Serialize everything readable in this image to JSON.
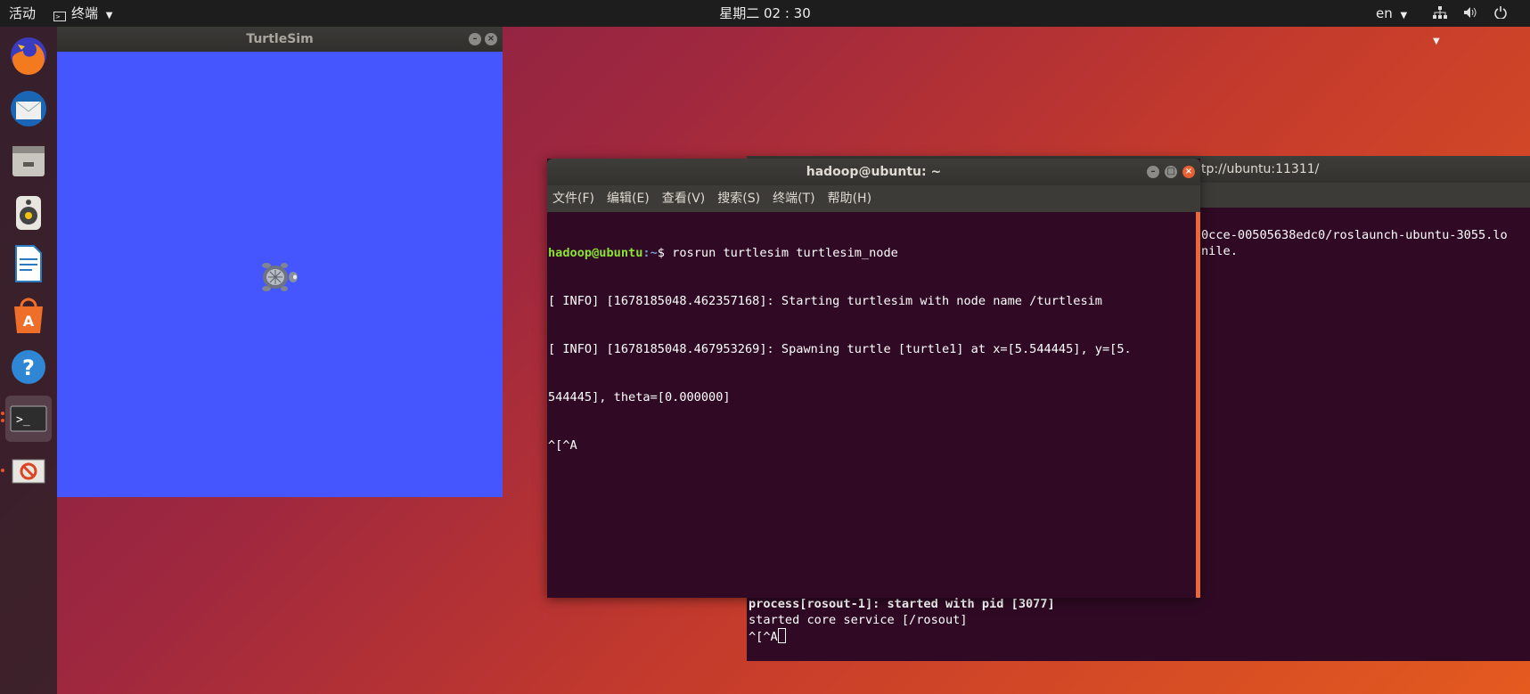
{
  "topbar": {
    "activities": "活动",
    "app_menu": "终端",
    "clock": "星期二 02 : 30",
    "lang": "en"
  },
  "dock": {
    "items": [
      "firefox-icon",
      "thunderbird-icon",
      "files-icon",
      "rhythmbox-icon",
      "libreoffice-writer-icon",
      "software-center-icon",
      "help-icon",
      "terminal-icon",
      "blocked-app-icon"
    ]
  },
  "turtlesim": {
    "title": "TurtleSim",
    "background_color": "#4556ff"
  },
  "term_back": {
    "title": "tp://ubuntu:11311/",
    "lines_top": [
      "0cce-00505638edc0/roslaunch-ubuntu-3055.lo",
      "nile."
    ],
    "line_pid": "process[rosout-1]: started with pid [3077]",
    "line_service": "started core service [/rosout]",
    "line_input": "^[^A"
  },
  "term_front": {
    "title": "hadoop@ubuntu: ~",
    "menu": [
      "文件(F)",
      "编辑(E)",
      "查看(V)",
      "搜索(S)",
      "终端(T)",
      "帮助(H)"
    ],
    "prompt_user": "hadoop@ubuntu",
    "prompt_path": ":~",
    "prompt_cmd": "$ rosrun turtlesim turtlesim_node",
    "lines": [
      "[ INFO] [1678185048.462357168]: Starting turtlesim with node name /turtlesim",
      "[ INFO] [1678185048.467953269]: Spawning turtle [turtle1] at x=[5.544445], y=[5.",
      "544445], theta=[0.000000]",
      "^[^A"
    ]
  }
}
